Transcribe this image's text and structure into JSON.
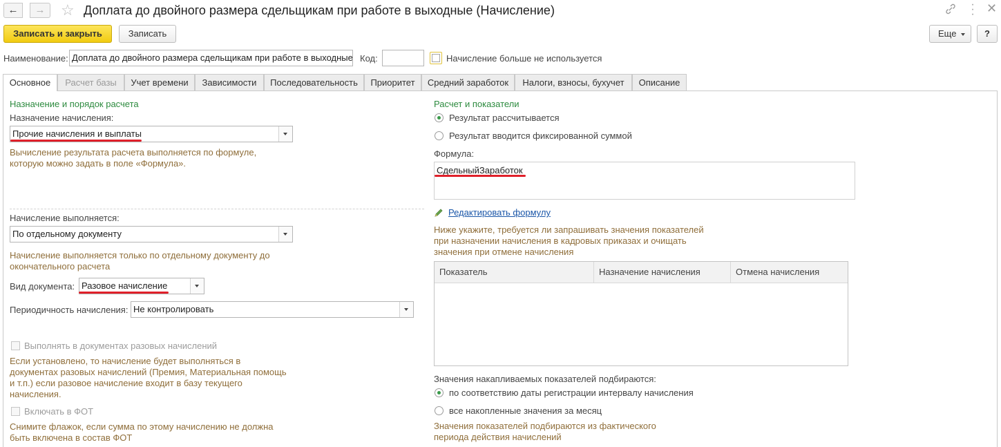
{
  "window": {
    "title": "Доплата до двойного размера сдельщикам при работе в выходные (Начисление)"
  },
  "toolbar": {
    "save_close_label": "Записать и закрыть",
    "save_label": "Записать",
    "more_label": "Еще",
    "help_label": "?"
  },
  "header": {
    "name_label": "Наименование:",
    "name_value": "Доплата до двойного размера сдельщикам при работе в выходные",
    "code_label": "Код:",
    "code_value": "",
    "not_used_label": "Начисление больше не используется"
  },
  "tabs": [
    {
      "label": "Основное"
    },
    {
      "label": "Расчет базы"
    },
    {
      "label": "Учет времени"
    },
    {
      "label": "Зависимости"
    },
    {
      "label": "Последовательность"
    },
    {
      "label": "Приоритет"
    },
    {
      "label": "Средний заработок"
    },
    {
      "label": "Налоги, взносы, бухучет"
    },
    {
      "label": "Описание"
    }
  ],
  "left": {
    "section_title": "Назначение и порядок расчета",
    "purpose_label": "Назначение начисления:",
    "purpose_value": "Прочие начисления и выплаты",
    "purpose_hint": [
      "Вычисление результата расчета выполняется по формуле,",
      "которую можно задать в поле «Формула»."
    ],
    "exec_label": "Начисление выполняется:",
    "exec_value": "По отдельному документу",
    "exec_hint": [
      "Начисление выполняется только по отдельному документу до",
      "окончательного расчета"
    ],
    "doc_kind_label": "Вид документа:",
    "doc_kind_value": "Разовое начисление",
    "period_label": "Периодичность начисления:",
    "period_value": "Не контролировать",
    "onetime_label": "Выполнять в документах разовых начислений",
    "onetime_hint": [
      "Если установлено, то начисление будет выполняться в",
      "документах разовых начислений (Премия, Материальная помощь",
      "и т.п.) если разовое начисление входит в базу текущего",
      "начисления."
    ],
    "fot_label": "Включать в ФОТ",
    "fot_hint": [
      "Снимите флажок, если сумма по этому начислению не должна",
      "быть включена в состав ФОТ"
    ]
  },
  "right": {
    "section_title": "Расчет и показатели",
    "radio_calc": "Результат рассчитывается",
    "radio_fixed": "Результат вводится фиксированной суммой",
    "formula_label": "Формула:",
    "formula_value": "СдельныйЗаработок",
    "edit_formula_link": "Редактировать формулу",
    "indicators_hint": [
      "Ниже укажите, требуется ли запрашивать значения показателей",
      "при назначении начисления в кадровых приказах и очищать",
      "значения при отмене начисления"
    ],
    "table_headers": [
      "Показатель",
      "Назначение начисления",
      "Отмена начисления"
    ],
    "accum_label": "Значения накапливаемых показателей подбираются:",
    "radio_interval": "по соответствию даты регистрации интервалу начисления",
    "radio_month": "все накопленные значения за месяц",
    "accum_hint": [
      "Значения показателей подбираются из фактического",
      "периода действия начислений"
    ]
  },
  "colors": {
    "primary_button": "#f1cb11",
    "section_green": "#2c8a3e",
    "hint_brown": "#8f6e3a",
    "link_blue": "#1a56a8",
    "annotation_red": "#e0202a"
  }
}
